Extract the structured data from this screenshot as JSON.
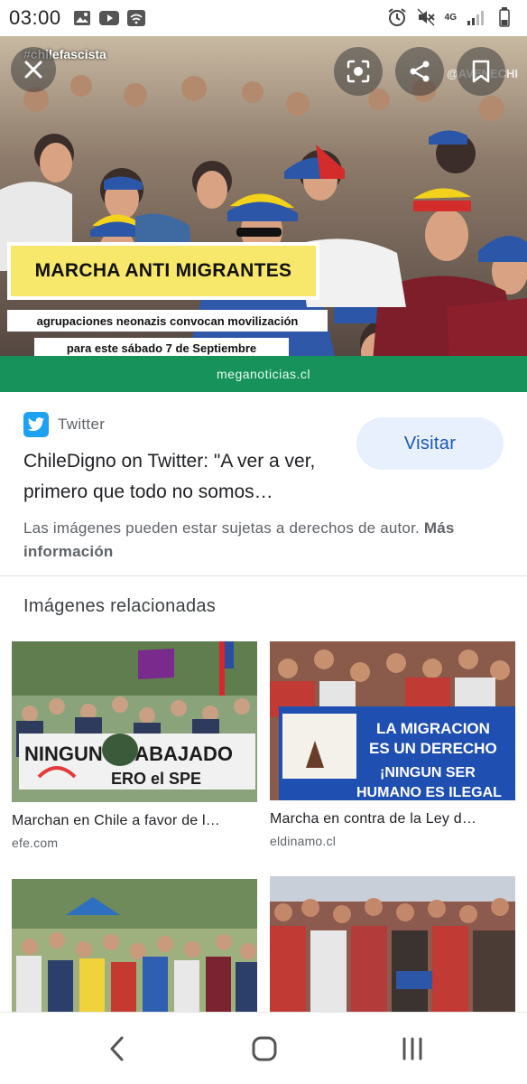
{
  "status_bar": {
    "time": "03:00",
    "network_type": "4G"
  },
  "hero": {
    "hashtag": "#chilefascista",
    "watermark": "@AVENECHI",
    "banner_title": "MARCHA ANTI MIGRANTES",
    "banner_line1": "agrupaciones neonazis convocan movilización",
    "banner_line2": "para este sábado 7 de Septiembre",
    "source_strip": "meganoticias.cl",
    "strip_color": "#16925a"
  },
  "result": {
    "source_name": "Twitter",
    "title": "ChileDigno on Twitter: \"A ver a ver, primero que todo no somos…",
    "visit_label": "Visitar",
    "copyright_text": "Las imágenes pueden estar sujetas a derechos de autor.",
    "more_info_label": "Más información"
  },
  "related": {
    "heading": "Imágenes relacionadas",
    "items": [
      {
        "caption": "Marchan en Chile a favor de l…",
        "domain": "efe.com",
        "sign_text": "NINGUN TRABAJADO",
        "sign_text2": "ERO el SPE"
      },
      {
        "caption": "Marcha en contra de la Ley d…",
        "domain": "eldinamo.cl",
        "banner_lines": [
          "LA MIGRACION",
          "ES UN DERECHO",
          "¡NINGUN SER",
          "HUMANO ES ILEGAL"
        ]
      },
      {
        "caption": "",
        "domain": ""
      },
      {
        "caption": "",
        "domain": ""
      }
    ]
  },
  "colors": {
    "accent_blue": "#1a57b8",
    "visit_bg": "#e8f0fe",
    "twitter_blue": "#1da1f2"
  }
}
